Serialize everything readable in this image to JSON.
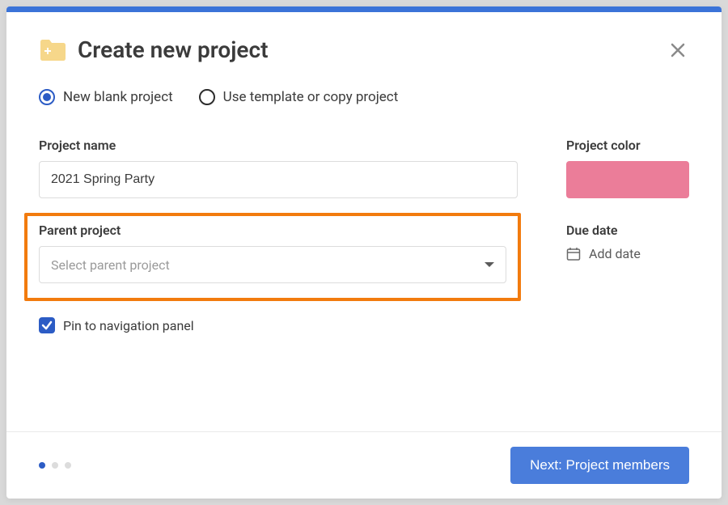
{
  "header": {
    "title": "Create new project"
  },
  "radios": {
    "blank": "New blank project",
    "template": "Use template or copy project"
  },
  "fields": {
    "project_name_label": "Project name",
    "project_name_value": "2021 Spring Party",
    "project_color_label": "Project color",
    "project_color_value": "#eb7d99",
    "parent_label": "Parent project",
    "parent_placeholder": "Select parent project",
    "due_label": "Due date",
    "due_add": "Add date",
    "pin_label": "Pin to navigation panel",
    "pin_checked": true
  },
  "footer": {
    "next_label": "Next: Project members",
    "step_active": 0,
    "step_count": 3
  }
}
